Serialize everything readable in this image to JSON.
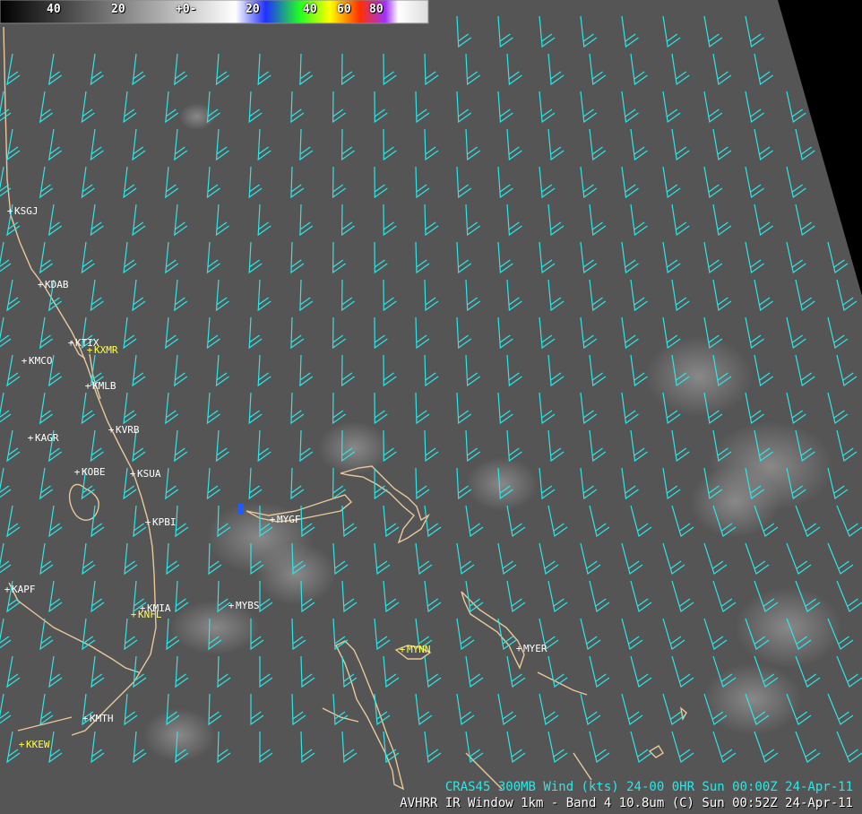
{
  "colorbar": {
    "labels": [
      "40",
      "20",
      "+0-",
      "20",
      "40",
      "60",
      "80"
    ],
    "colors": {
      "warm_start": "#000000",
      "warm_end": "#ffffff",
      "cold_1": "#2030ff",
      "cold_2": "#20ff20",
      "cold_3": "#ffff00",
      "cold_4": "#ff3000",
      "cold_5": "#a030ff"
    }
  },
  "stations": [
    {
      "id": "KSGJ",
      "color": "#ffffff"
    },
    {
      "id": "KDAB",
      "color": "#ffffff"
    },
    {
      "id": "KTIX",
      "color": "#ffffff"
    },
    {
      "id": "KXMR",
      "color": "#ffff55"
    },
    {
      "id": "KMCO",
      "color": "#ffffff"
    },
    {
      "id": "KMLB",
      "color": "#ffffff"
    },
    {
      "id": "KVRB",
      "color": "#ffffff"
    },
    {
      "id": "KAGR",
      "color": "#ffffff"
    },
    {
      "id": "KOBE",
      "color": "#ffffff"
    },
    {
      "id": "KSUA",
      "color": "#ffffff"
    },
    {
      "id": "KPBI",
      "color": "#ffffff"
    },
    {
      "id": "MYGF",
      "color": "#ffffff"
    },
    {
      "id": "KAPF",
      "color": "#ffffff"
    },
    {
      "id": "KMIA",
      "color": "#ffffff"
    },
    {
      "id": "KNFL",
      "color": "#ffff55"
    },
    {
      "id": "MYBS",
      "color": "#ffffff"
    },
    {
      "id": "MYNN",
      "color": "#ffff55"
    },
    {
      "id": "MYER",
      "color": "#ffffff"
    },
    {
      "id": "KMTH",
      "color": "#ffffff"
    },
    {
      "id": "KKEW",
      "color": "#ffff55"
    }
  ],
  "overlay": {
    "caption": "CRAS45 300MB  Wind (kts)  24-00   0HR Sun 00:00Z 24-Apr-11",
    "barb_color": "#2ee6e6"
  },
  "base": {
    "caption": "AVHRR IR Window 1km - Band 4 10.8um (C)  Sun 00:52Z 24-Apr-11"
  },
  "colors": {
    "coast": "#e8c89a",
    "background": "#555555",
    "swath_edge": "#000000"
  }
}
